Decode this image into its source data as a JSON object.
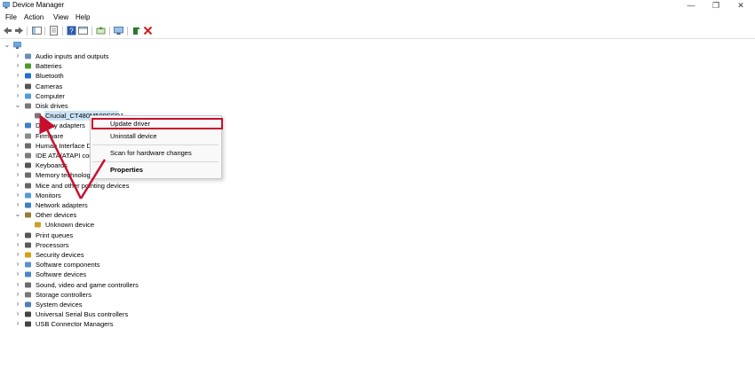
{
  "window": {
    "title": "Device Manager"
  },
  "menu": [
    "File",
    "Action",
    "View",
    "Help"
  ],
  "window_controls": {
    "minimize": "—",
    "maximize": "❐",
    "close": "✕"
  },
  "tree": {
    "root_icon": "computer-icon",
    "items": [
      {
        "label": "Audio inputs and outputs",
        "icon": "speaker-icon",
        "expanded": false
      },
      {
        "label": "Batteries",
        "icon": "battery-icon",
        "expanded": false
      },
      {
        "label": "Bluetooth",
        "icon": "bluetooth-icon",
        "expanded": false
      },
      {
        "label": "Cameras",
        "icon": "camera-icon",
        "expanded": false
      },
      {
        "label": "Computer",
        "icon": "monitor-icon",
        "expanded": false
      },
      {
        "label": "Disk drives",
        "icon": "disk-icon",
        "expanded": true
      },
      {
        "label": "Crucial_CT480M500SSD1",
        "icon": "disk-icon",
        "child": true,
        "selected": true
      },
      {
        "label": "Display adapters",
        "icon": "display-adapter-icon",
        "expanded": false
      },
      {
        "label": "Firmware",
        "icon": "chip-icon",
        "expanded": false
      },
      {
        "label": "Human Interface D",
        "icon": "hid-icon",
        "expanded": false
      },
      {
        "label": "IDE ATA/ATAPI con",
        "icon": "ide-icon",
        "expanded": false
      },
      {
        "label": "Keyboards",
        "icon": "keyboard-icon",
        "expanded": false
      },
      {
        "label": "Memory technology",
        "icon": "memory-icon",
        "expanded": false
      },
      {
        "label": "Mice and other pointing devices",
        "icon": "mouse-icon",
        "expanded": false
      },
      {
        "label": "Monitors",
        "icon": "monitor-icon",
        "expanded": false
      },
      {
        "label": "Network adapters",
        "icon": "network-icon",
        "expanded": false
      },
      {
        "label": "Other devices",
        "icon": "other-device-icon",
        "expanded": true
      },
      {
        "label": "Unknown device",
        "icon": "unknown-device-icon",
        "child": true
      },
      {
        "label": "Print queues",
        "icon": "printer-icon",
        "expanded": false
      },
      {
        "label": "Processors",
        "icon": "processor-icon",
        "expanded": false
      },
      {
        "label": "Security devices",
        "icon": "security-icon",
        "expanded": false
      },
      {
        "label": "Software components",
        "icon": "software-component-icon",
        "expanded": false
      },
      {
        "label": "Software devices",
        "icon": "software-device-icon",
        "expanded": false
      },
      {
        "label": "Sound, video and game controllers",
        "icon": "sound-icon",
        "expanded": false
      },
      {
        "label": "Storage controllers",
        "icon": "storage-icon",
        "expanded": false
      },
      {
        "label": "System devices",
        "icon": "system-icon",
        "expanded": false
      },
      {
        "label": "Universal Serial Bus controllers",
        "icon": "usb-icon",
        "expanded": false
      },
      {
        "label": "USB Connector Managers",
        "icon": "usb-icon",
        "expanded": false
      }
    ]
  },
  "context_menu": {
    "update_driver": "Update driver",
    "uninstall_device": "Uninstall device",
    "scan_hardware": "Scan for hardware changes",
    "properties": "Properties"
  },
  "colors": {
    "highlight": "#c8102e",
    "arrow": "#c8102e",
    "selection": "#cce4f7"
  }
}
